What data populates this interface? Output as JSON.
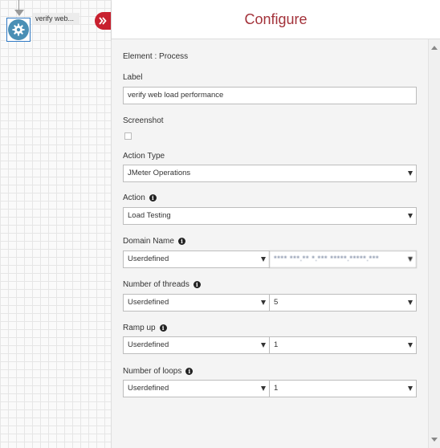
{
  "canvas": {
    "node": {
      "label": "verify web...",
      "icon": "gear-icon"
    },
    "collapse_icon": "double-chevron-right-icon"
  },
  "panel": {
    "title": "Configure",
    "element_line": "Element : Process",
    "label": {
      "caption": "Label",
      "value": "verify web load performance"
    },
    "screenshot": {
      "caption": "Screenshot",
      "checked": false
    },
    "action_type": {
      "caption": "Action Type",
      "value": "JMeter Operations"
    },
    "action": {
      "caption": "Action",
      "value": "Load Testing"
    },
    "domain_name": {
      "caption": "Domain Name",
      "mode": "Userdefined",
      "value": "**** ***.** *.*** *****.*****.***"
    },
    "threads": {
      "caption": "Number of threads",
      "mode": "Userdefined",
      "value": "5"
    },
    "ramp_up": {
      "caption": "Ramp up",
      "mode": "Userdefined",
      "value": "1"
    },
    "loops": {
      "caption": "Number of loops",
      "mode": "Userdefined",
      "value": "1"
    }
  },
  "colors": {
    "accent": "#c8202f",
    "title": "#a3323a",
    "node": "#4a8fb5"
  }
}
